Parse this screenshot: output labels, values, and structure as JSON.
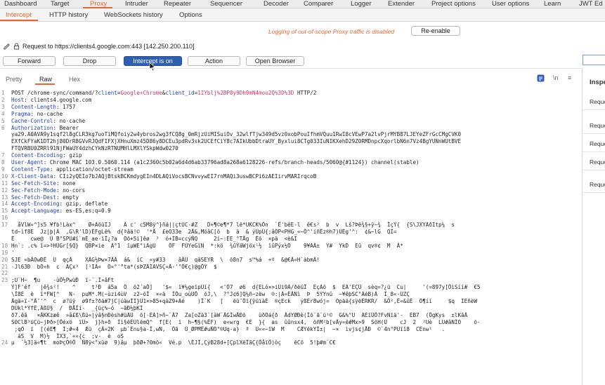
{
  "top_tabs": [
    "Dashboard",
    "Target",
    "Proxy",
    "Intruder",
    "Repeater",
    "Sequencer",
    "Decoder",
    "Comparer",
    "Logger",
    "Extender",
    "Project options",
    "User options",
    "Learn",
    "JWT Ed"
  ],
  "top_active": "Proxy",
  "sub_tabs": [
    "Intercept",
    "HTTP history",
    "WebSockets history",
    "Options"
  ],
  "sub_active": "Intercept",
  "notice": "Logging of out-of-scope Proxy traffic is disabled",
  "reenable_label": "Re-enable",
  "request_to": "Request to https://clients4.google.com:443  [142.250.200.110]",
  "buttons": {
    "forward": "Forward",
    "drop": "Drop",
    "intercept": "Intercept is on",
    "action": "Action",
    "open_browser": "Open Browser"
  },
  "view_tabs": [
    "Pretty",
    "Raw",
    "Hex"
  ],
  "view_active": "Raw",
  "icons": {
    "wrap": "\\n",
    "menu": "≡"
  },
  "inspector": {
    "title": "Inspector",
    "rows": [
      "Reque",
      "Reque",
      "Reque",
      "Reque",
      "Reque"
    ]
  },
  "lines": [
    {
      "n": "1",
      "t": "POST /chrome-sync/command/?client=Google+Chrome&client_id=1IYblj%2BP8y9Dh9mN4mou2Q%3D%3D HTTP/2"
    },
    {
      "n": "2",
      "t": "Host: clients4.google.com"
    },
    {
      "n": "3",
      "t": "Content-Length: 1757"
    },
    {
      "n": "4",
      "t": "Pragma: no-cache"
    },
    {
      "n": "5",
      "t": "Cache-Control: no-cache"
    },
    {
      "n": "6",
      "t": "Authorization: Bearer"
    },
    {
      "n": "",
      "t": "ya29.A0AVA9y1sqf2l8gCLR3kg7uoTiMQfoiy2w4ybros2wg3fCQ8g_0mRjzUiMISuiOv_32wlfTjw349d5vz0xobPouIfhmVQuu1RwI8cVEwP7a2lvPjrMYB87LJEYeZFrGcCMgCVK0"
    },
    {
      "n": "",
      "t": "EXfCkFYaK1DT2hj80DrR8GVvRJQdFIFXjXHnuXmz45D86y8DCEu3pdRv3sk2UCEfCiY8c7AIkUbbDtraUY_Byxlui8CTg033IuNIKXehD29Z0RMDnpcXqorlbN6n7Vz4BgYUNnWUtBVE"
    },
    {
      "n": "",
      "t": "FTQVRBU0ZRRl91NjFWaUY4dzhCYkNzRTNUMHlLMXlYSkpWdw0270"
    },
    {
      "n": "7",
      "t": "Content-Encoding: gzip"
    },
    {
      "n": "8",
      "t": "User-Agent: Chrome MAC 103.0.5060.114 (a1c2360c5b02a6d4d6ab33796ad8a268a6128226-refs/branch-heads/5060@{#1124}) channel(stable)"
    },
    {
      "n": "9",
      "t": "Content-Type: application/octet-stream"
    },
    {
      "n": "10",
      "t": "X-Client-Data: CIi2yQEIo7bJAQjBtskBCKmdygEIn4DLAQiVocsBCNvvywEI7rnMAQi3uswBCPi6zAEIirvMARIrqcoB"
    },
    {
      "n": "11",
      "t": "Sec-Fetch-Site: none"
    },
    {
      "n": "12",
      "t": "Sec-Fetch-Mode: no-cors"
    },
    {
      "n": "13",
      "t": "Sec-Fetch-Dest: empty"
    },
    {
      "n": "14",
      "t": "Accept-Encoding: gzip, deflate"
    },
    {
      "n": "15",
      "t": "Accept-Language: es-ES,es;q=0.9"
    },
    {
      "n": "16",
      "t": ""
    },
    {
      "n": "17",
      "t": "  åVlW«^]s5 ¥fb!Làx^    Ø+ÀöüIJ    Â c' c5M8ÿ^}ñä||çtÜC-#Z   D+¶©e¶*7 lë*UKCK%Õn  `Ë'bêE-l  ê€s²  b  v  Lš?Þë¾§+ÿ~¾  ÏçÝ{  {S\\JXYÀðItp¼  s"
    },
    {
      "n": "",
      "t": "td~ìf8É  Jz|þ|Á  ,G\\R'lD)ÉFgLë%  d{ªâä!©  '*Å  £eO33e  2Å&,MöâC[ö  b  ä  & ýÜpÜ{;âÖP<PHG_«~Õ^'íñÊz®h7)ÜÊg'^:  ¢&~lG  QÎ="
    },
    {
      "n": "",
      "t": "Ê     cwe@  Û B°SPÜ#í¨mÈ_ae-ìÏ¿?a  Öö+5i]êø  ³  ó+ÍB=ccýÑQ     2í~:ÈE_°TÅg  Êõ  ×pä  <è&Î"
    },
    {
      "n": "18",
      "t": "Hn`: .c% î=>ªHÙGr[§Q}  QBP×ie  Á°1  ïµWE°iAgU    ÓF  FÜYeGïN  *:kö  ¾ûŸäWjöx¹½  ïûPýx½Ö    9¥ÀÄ±  Ý#  YkD  Eû  qv®¢  M  Ã*"
    },
    {
      "n": "19",
      "t": "'"
    },
    {
      "n": "20",
      "t": "SJE «bÃOwÐÊ  Ü  qçÃ    XÃG½Þw×7ÃÄ  á&  íC  «y#33    âÄÜ  qâSEYR  \\  õ8n7  s™%á  +º  &@€Ã«H`àbmÄ!"
    },
    {
      "n": "21",
      "t": "-Jl63Ð  bÖ»h  c  ÁÇx³  [¹IÂ«  Ö«°'°ta*(sÞZÄÍAVSÇ«Ä-'°Ô€ç)@gÕÝ  $"
    },
    {
      "n": "22",
      "t": ""
    },
    {
      "n": "23",
      "t": ";U¨H~  ¶u    -ùÕ½PwüÐ  ï-¨.Î¤âFt"
    },
    {
      "n": "",
      "t": "Ý]F'éf   |ê¾s²!    ^     t³Ð  á5a  Ö  õ2´aÕ]   '$«  ï¥¼geïpÜí{   <'Ö7  ø6  d{ELó×>iÜi9Á/ðëüÏ  ÈçÁõ  $  EÁ'ÉÇÛ  sèq=?¿ü  Cu|     '(=897y[ÕìSíí#  €5"
    },
    {
      "n": "",
      "t": "\\Î8É  è  î*FW[^   N·  puM*.M(~ùzi4ùV  z2~õÎ  ×«ä  ÎÔu_oùÜÕ  õJ,\\  ?°J¢6]Q¼ñ~zëw  ®:|Â«ÊÃNì  Þ  5ÝYnû  ~¥êþSC°ÁéB)Â  Î_8«-ÜZÇ"
    },
    {
      "n": "",
      "t": "Ägä«ï-°Â¯'^  c  ø?üÿ  ø9f±?ðá#7jC|úäwÌÍ}Ü1×>85+qàZ9+Áé    )Ï`K   [   ëü¯Õï{ÿüïàÈ  ®çEck   ýßÈr8wój=  Opää{sÿëÊRKR/  &Õ²,Ë«&ûÊ  Ô¶íí     $q  ÌÉñèW"
    },
    {
      "n": "",
      "t": "DÙkl*ÝfÊ,ÄßÙ§  /  ÐÅÎí-  _{üç%~ó  ~ãÐ½þKÎ"
    },
    {
      "n": "",
      "t": "ð7.êâ   ×ÄKKzæê  »â£ß\\ßü«|ýâ§nÐèsh#üÀÜ  õ[-ÊÁ]>ñ~¨Ä7  Za[oZä3¨[àW¨ÃGÎwÅÐõ    üðÖá{ð  ÄdYØÐè(Îõ¨ã¨ü¹©  G&%°U  ÀÉïÜÕ?FvNïä'-  ÉB7  (ÕgKys  ±lKãÄ"
    },
    {
      "n": "",
      "t": "S0ClB³üÇü~jÞð>[Õéxö  ïÜ>  j}h+ð  Ìì§ëÉÜlëmQ^  f[E(  ï  h~¶§(%ËF)  e«wrg  €É  }{  as  ûûnsx4,  öñM²b[vÃy«ë#Mx>9  SöH(Ù    cJ  2  ²Uè  LU#âNÎO    õ-"
    },
    {
      "n": "",
      "t": " ;qO  ï  [(éE¶  Ì;#«4  Æü  çÄ«2K  µb`Ênu§a-Î,wN,  Õã  Û_ØPMÉ#uÑÖ°®Uq-a}  ª  Ü««~ïW  M    CÆYëkYÌ±|  ~×  ìvjs¢jÅÐ  ©`4n°PÜïî8  CÈnw¹   ."
    },
    {
      "n": "",
      "t": "  áS  V  M)½  ÏX3,`««{c  ;v-  è  oS"
    },
    {
      "n": "24",
      "t": "µ  `½3]ä«¶t  moÞçÖ®Õ  Ñ8ÿ<°xüø  9)âµ  þðØ+?0mö«  Vé.p  \\ÊJÎ,ÇýB28d+[ÇplXëÏãÇ{ÕåïÕ)òç    ëCö  5!þ#m¨C€"
    }
  ]
}
